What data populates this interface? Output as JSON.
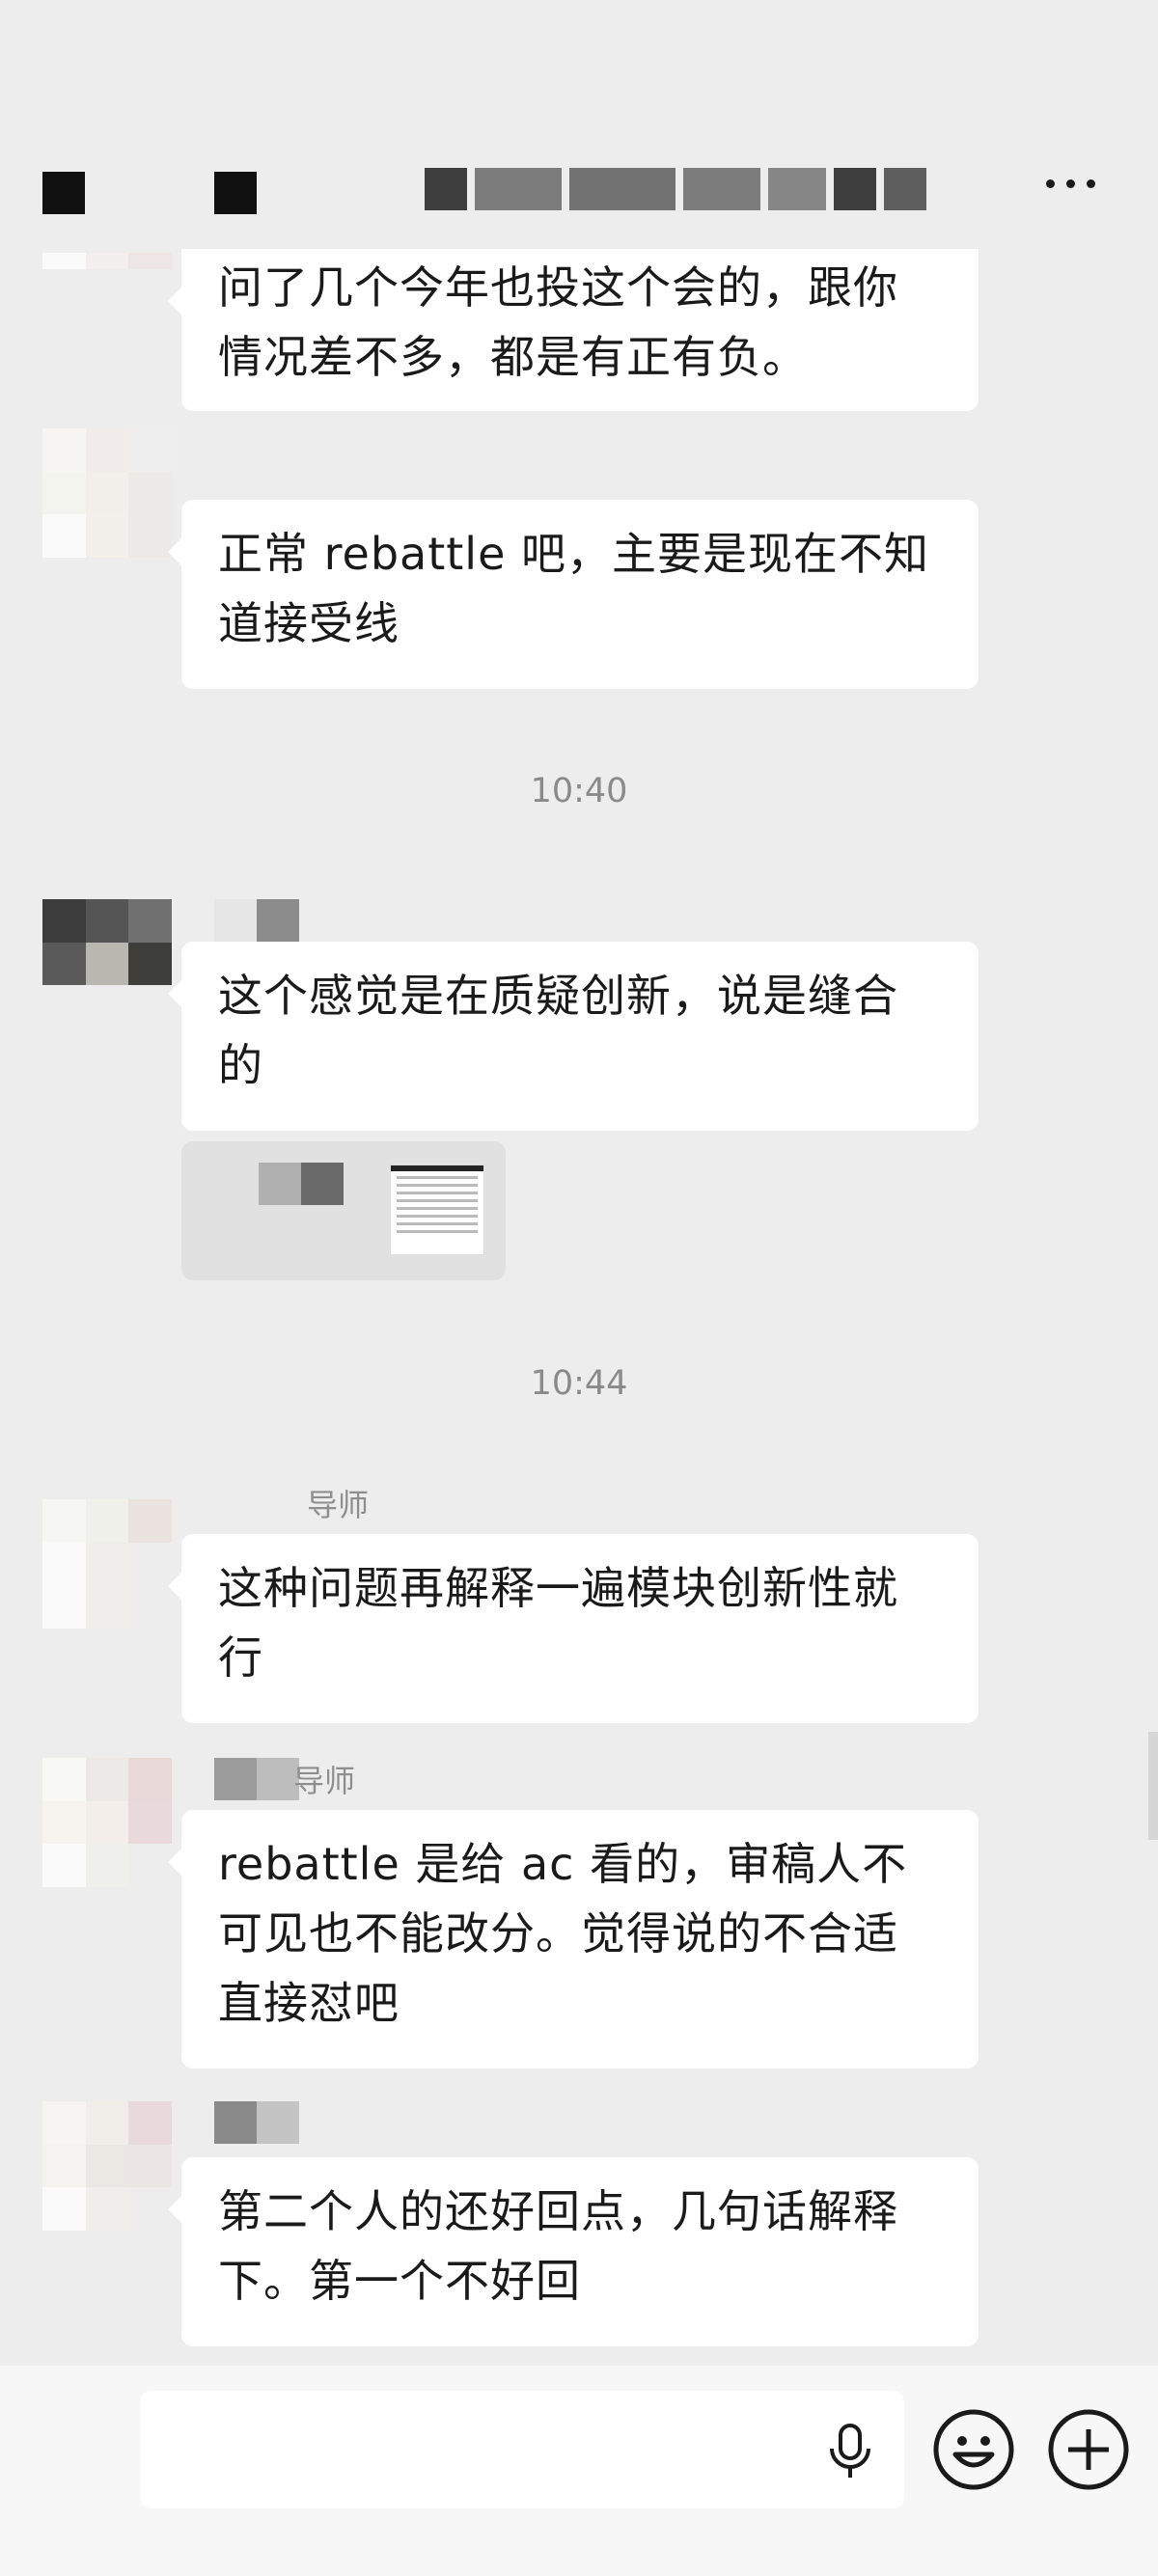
{
  "chat": {
    "times": [
      "10:40",
      "10:44"
    ],
    "messages": [
      {
        "text": "问了几个今年也投这个会的，跟你情况差不多，都是有正有负。"
      },
      {
        "text": "正常 rebattle 吧，主要是现在不知道接受线"
      },
      {
        "text": "这个感觉是在质疑创新，说是缝合的"
      },
      {
        "text": "这种问题再解释一遍模块创新性就行",
        "sender_suffix": "导师"
      },
      {
        "text": "rebattle 是给 ac 看的，审稿人不可见也不能改分。觉得说的不合适直接怼吧",
        "sender_suffix": "导师"
      },
      {
        "text": "第二个人的还好回点，几句话解释下。第一个不好回"
      }
    ]
  },
  "icons": {
    "more": "more-dots-icon",
    "voice": "microphone-icon",
    "emoji": "emoji-icon",
    "plus": "plus-icon"
  },
  "colors": {
    "background": "#ededed",
    "bubble": "#ffffff",
    "bottom_bar": "#f7f7f7"
  }
}
